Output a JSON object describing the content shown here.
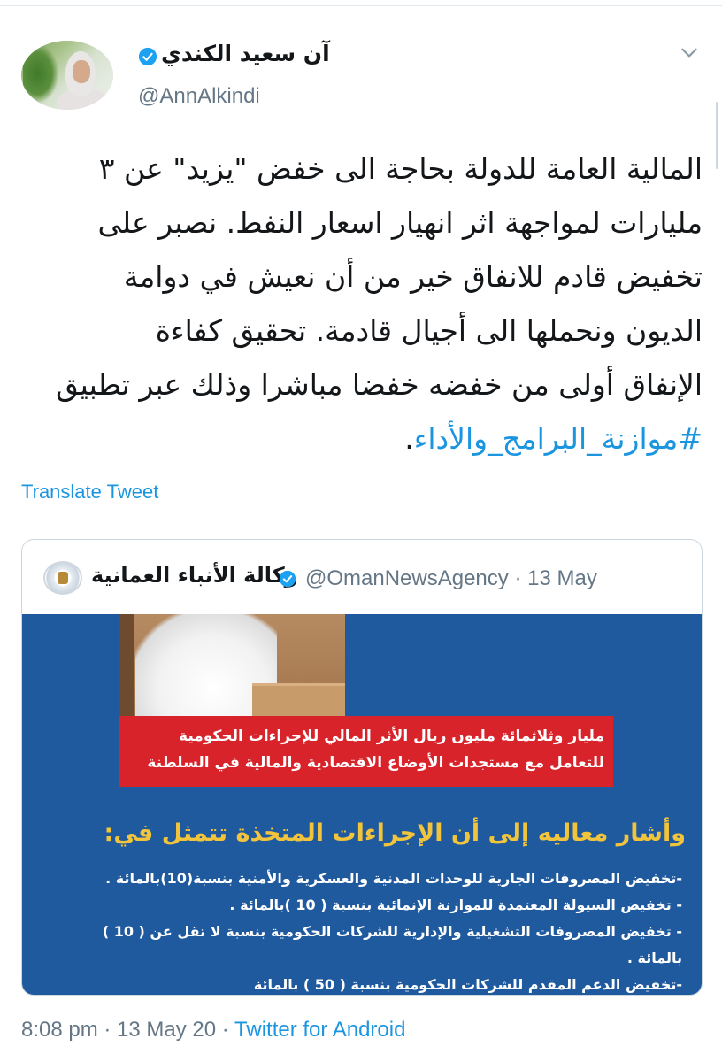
{
  "author": {
    "display_name": "آن سعيد الكندي",
    "handle": "@AnnAlkindi"
  },
  "tweet": {
    "lines": [
      "المالية العامة للدولة بحاجة الى خفض \"يزيد\" عن ٣",
      "مليارات لمواجهة اثر انهيار اسعار النفط. نصبر على",
      "تخفيض قادم للانفاق خير من أن نعيش في دوامة",
      "الديون ونحملها الى أجيال قادمة. تحقيق كفاءة",
      "الإنفاق أولى من خفضه خفضا مباشرا وذلك عبر تطبيق"
    ],
    "hashtag": "#موازنة_البرامج_والأداء",
    "hashtag_suffix": "."
  },
  "translate_label": "Translate Tweet",
  "quoted": {
    "display_name": "وكالة الأنباء العمانية",
    "handle_date": "@OmanNewsAgency · 13 May",
    "image": {
      "banner_lines": [
        "مليار وثلاثمائة مليون ريال الأثر المالي للإجراءات الحكومية",
        "للتعامل مع مستجدات الأوضاع الاقتصادية والمالية في السلطنة"
      ],
      "heading": "وأشار معاليه إلى أن الإجراءات المتخذة تتمثل في:",
      "bullets": [
        "-تخفيض المصروفات الجارية للوحدات المدنية والعسكرية والأمنية بنسبة(10)بالمائة .",
        "- تخفيض السيولة المعتمدة للموازنة الإنمائية بنسبة ( 10 )بالمائة .",
        "- تخفيض المصروفات التشغيلية والإدارية للشركات الحكومية بنسبة لا تقل عن ( 10 )",
        "بالمائة .",
        "-تخفيض الدعم المقدم للشركات الحكومية بنسبة ( 50 ) بالمائة"
      ]
    }
  },
  "meta": {
    "time": "8:08 pm",
    "separator": " · ",
    "date": "13 May 20",
    "source": "Twitter for Android"
  },
  "colors": {
    "link": "#1b95e0",
    "secondary_text": "#657786",
    "border": "#ccd6dd",
    "image_bg": "#1f5a9e",
    "banner_red": "#d8232a",
    "heading_yellow": "#f2c43c"
  },
  "icons": {
    "verified": "verified-badge-icon",
    "more": "chevron-down-icon"
  }
}
